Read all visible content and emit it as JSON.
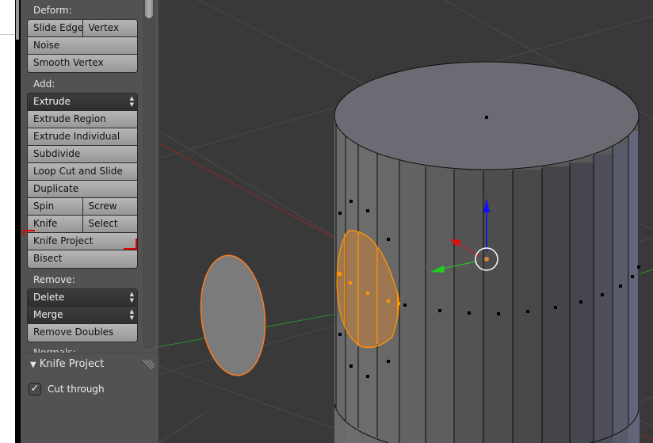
{
  "panel": {
    "sections": {
      "deform": {
        "label": "Deform:",
        "buttons": [
          [
            "Slide Edge",
            "Vertex"
          ],
          [
            "Noise"
          ],
          [
            "Smooth Vertex"
          ]
        ]
      },
      "add": {
        "label": "Add:",
        "extrude_dropdown": "Extrude",
        "buttons": [
          [
            "Extrude Region"
          ],
          [
            "Extrude Individual"
          ],
          [
            "Subdivide"
          ],
          [
            "Loop Cut and Slide"
          ],
          [
            "Duplicate"
          ],
          [
            "Spin",
            "Screw"
          ],
          [
            "Knife",
            "Select"
          ],
          [
            "Knife Project"
          ],
          [
            "Bisect"
          ]
        ]
      },
      "remove": {
        "label": "Remove:",
        "delete_dropdown": "Delete",
        "merge_dropdown": "Merge",
        "remove_doubles": "Remove Doubles"
      },
      "normals": {
        "label": "Normals:"
      }
    },
    "highlighted_button": "Knife Project"
  },
  "operator_panel": {
    "title": "Knife Project",
    "options": [
      {
        "label": "Cut through",
        "checked": true
      }
    ]
  },
  "viewport": {
    "objects": [
      {
        "name": "Cylinder",
        "mode": "edit"
      },
      {
        "name": "Ellipse cutter",
        "selected": true
      }
    ],
    "colors": {
      "background": "#393939",
      "grid": "#4a4a4a",
      "x_axis": "#8f2a2a",
      "y_axis": "#3a9a2a",
      "selection": "#ff9500",
      "active_outline": "#ff7b1f",
      "gizmo_x": "#e01010",
      "gizmo_y": "#20d020",
      "gizmo_z": "#1010ff"
    }
  }
}
